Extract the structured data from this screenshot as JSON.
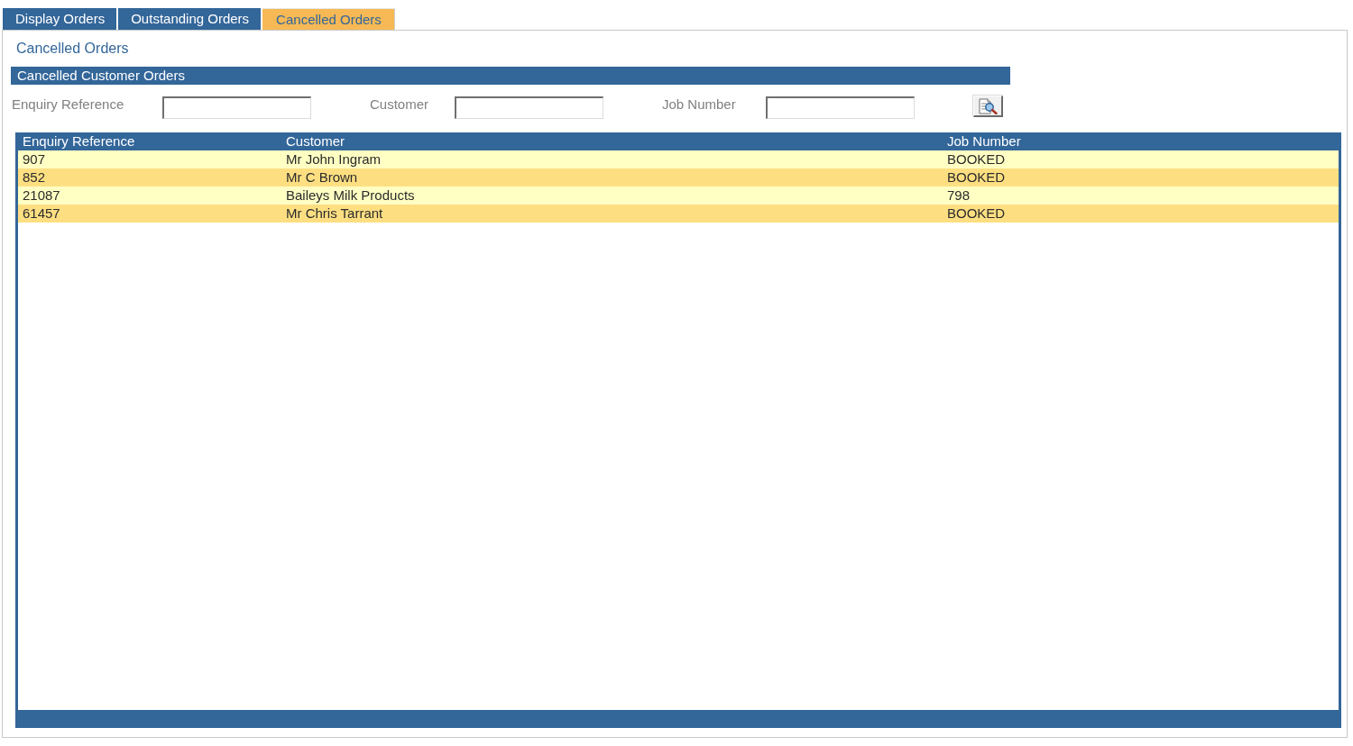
{
  "tabs": [
    {
      "label": "Display Orders",
      "selected": false
    },
    {
      "label": "Outstanding Orders",
      "selected": false
    },
    {
      "label": "Cancelled Orders",
      "selected": true
    }
  ],
  "page_title": "Cancelled Orders",
  "section": {
    "title": "Cancelled Customer Orders"
  },
  "filters": [
    {
      "label": "Enquiry Reference"
    },
    {
      "label": "Customer"
    },
    {
      "label": "Job Number"
    }
  ],
  "table": {
    "columns": [
      "Enquiry Reference",
      "Customer",
      "Job Number"
    ],
    "rows": [
      [
        "907",
        "Mr John Ingram",
        "BOOKED"
      ],
      [
        "852",
        "Mr C Brown",
        "BOOKED"
      ],
      [
        "21087",
        "Baileys Milk Products",
        "798"
      ],
      [
        "61457",
        "Mr Chris Tarrant",
        "BOOKED"
      ]
    ]
  }
}
